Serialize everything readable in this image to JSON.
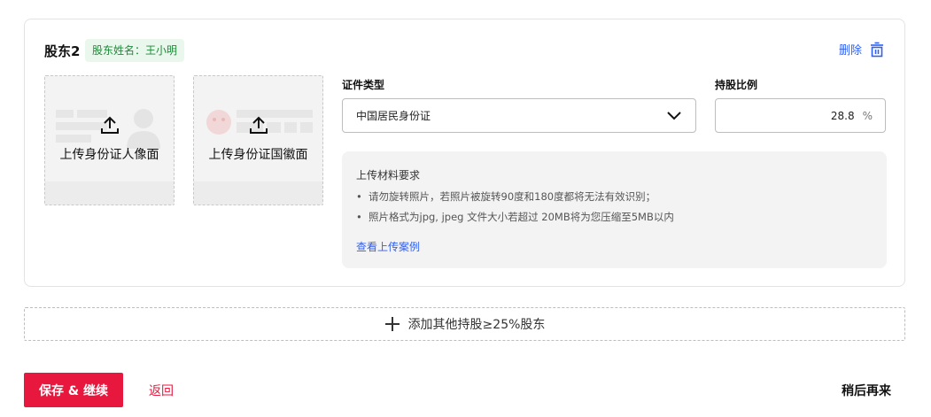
{
  "shareholder": {
    "title": "股东2",
    "name_badge": "股东姓名：王小明",
    "delete_label": "删除"
  },
  "uploads": [
    {
      "label": "上传身份证人像面",
      "icon": "upload-icon"
    },
    {
      "label": "上传身份证国徽面",
      "icon": "upload-icon"
    }
  ],
  "id_type": {
    "label": "证件类型",
    "value": "中国居民身份证"
  },
  "ratio": {
    "label": "持股比例",
    "value": "28.8",
    "unit": "%"
  },
  "requirements": {
    "title": "上传材料要求",
    "items": [
      "请勿旋转照片，若照片被旋转90度和180度都将无法有效识别；",
      "照片格式为jpg, jpeg 文件大小若超过 20MB将为您压缩至5MB以内"
    ],
    "link": "查看上传案例"
  },
  "add_shareholder": "添加其他持股≥25%股东",
  "footer": {
    "save_label": "保存 & 继续",
    "back_label": "返回",
    "later_label": "稍后再来"
  },
  "colors": {
    "primary": "#e8173d",
    "link": "#2f5ff3",
    "badge_text": "#1f8a3a",
    "badge_bg": "#eaf7ec"
  }
}
